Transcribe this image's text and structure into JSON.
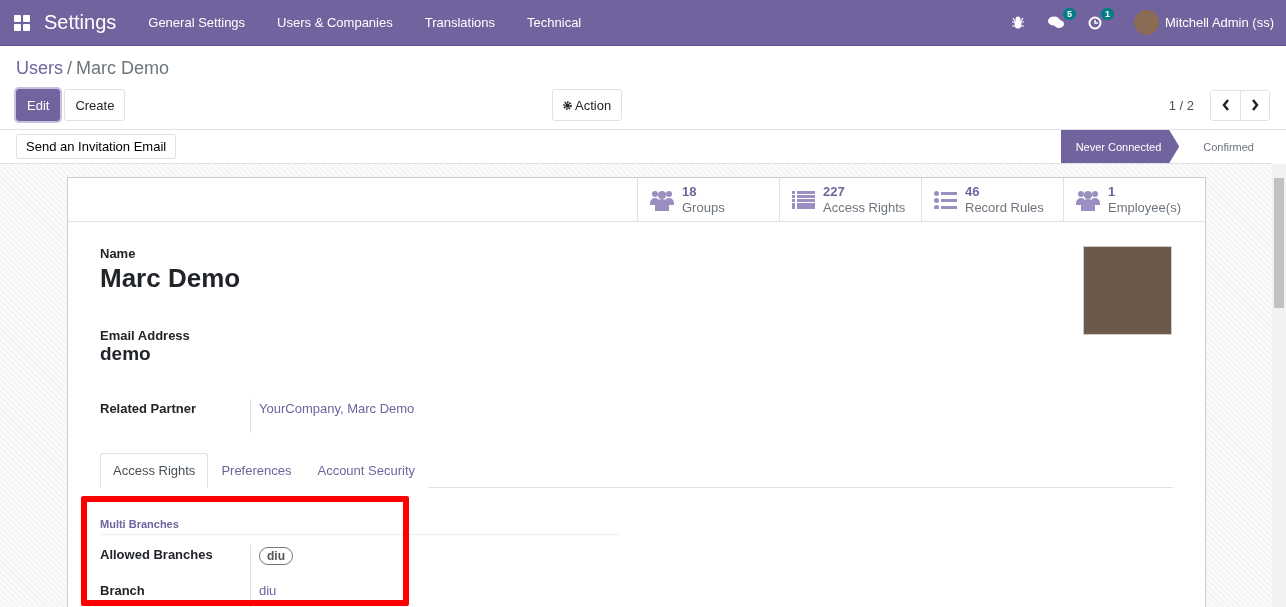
{
  "navbar": {
    "app_title": "Settings",
    "menu": [
      "General Settings",
      "Users & Companies",
      "Translations",
      "Technical"
    ],
    "messages_count": "5",
    "activities_count": "1",
    "user": "Mitchell Admin (ss)"
  },
  "breadcrumb": {
    "parent": "Users",
    "separator": "/",
    "current": "Marc Demo"
  },
  "control_panel": {
    "buttons": [
      {
        "label": "Edit",
        "primary": true
      },
      {
        "label": "Create",
        "primary": false
      }
    ],
    "action": "Action",
    "pager": "1 / 2"
  },
  "status_bar": {
    "button": "Send an Invitation Email",
    "stages": [
      {
        "label": "Never Connected",
        "selected": true
      },
      {
        "label": "Confirmed",
        "selected": false
      }
    ]
  },
  "stat_buttons": [
    {
      "kind": "users",
      "value": "18",
      "label": "Groups"
    },
    {
      "kind": "list",
      "value": "227",
      "label": "Access Rights"
    },
    {
      "kind": "bullets",
      "value": "46",
      "label": "Record Rules"
    },
    {
      "kind": "users",
      "value": "1",
      "label": "Employee(s)"
    }
  ],
  "form": {
    "name_label": "Name",
    "name": "Marc Demo",
    "email_label": "Email Address",
    "email": "demo",
    "partner_label": "Related Partner",
    "partner": "YourCompany, Marc Demo"
  },
  "tabs": [
    {
      "label": "Access Rights",
      "selected": true
    },
    {
      "label": "Preferences",
      "selected": false
    },
    {
      "label": "Account Security",
      "selected": false
    }
  ],
  "section": {
    "title": "Multi Branches",
    "highlighted": true,
    "fields": [
      {
        "kind": "tags",
        "label": "Allowed Branches",
        "value": "diu"
      },
      {
        "kind": "link",
        "label": "Branch",
        "value": "diu"
      }
    ]
  }
}
